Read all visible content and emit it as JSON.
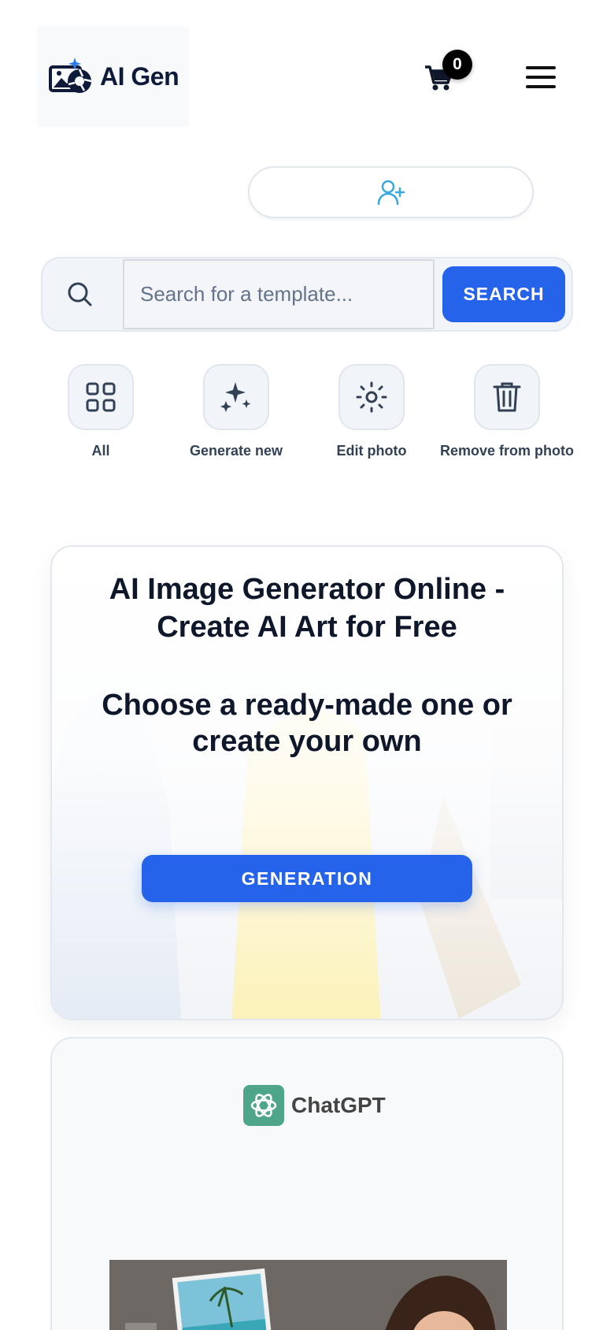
{
  "header": {
    "logo_text": "AI Gen",
    "cart_count": "0"
  },
  "search": {
    "placeholder": "Search for a template...",
    "button_label": "SEARCH"
  },
  "categories": [
    {
      "label": "All",
      "icon": "grid-icon"
    },
    {
      "label": "Generate new",
      "icon": "sparkles-icon"
    },
    {
      "label": "Edit photo",
      "icon": "sun-icon"
    },
    {
      "label": "Remove from photo",
      "icon": "trash-icon"
    }
  ],
  "hero": {
    "title": "AI Image Generator Online - Create AI Art for Free",
    "subtitle": "Choose a ready-made one or create your own",
    "button_label": "GENERATION"
  },
  "template_card": {
    "brand_name": "ChatGPT"
  },
  "colors": {
    "accent": "#2563eb",
    "text": "#0f172a",
    "muted": "#334155",
    "tile_bg": "#f1f4f9",
    "gpt_green": "#4fa58a"
  }
}
